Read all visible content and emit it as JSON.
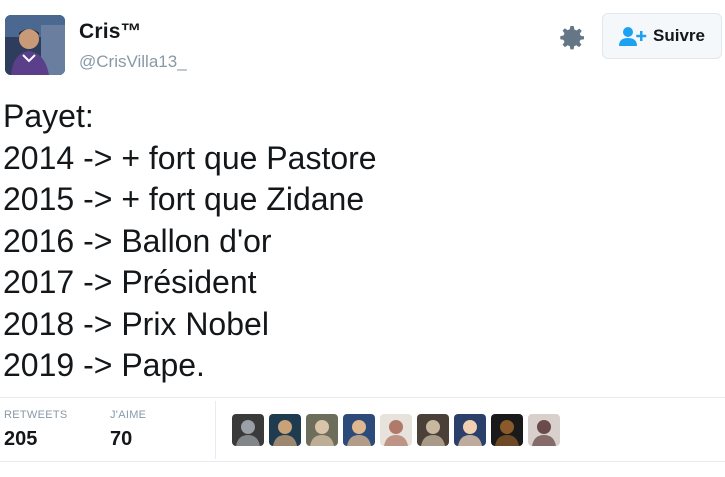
{
  "user": {
    "display_name": "Cris™",
    "screen_name": "@CrisVilla13_",
    "avatar_icon": "profile-photo"
  },
  "header": {
    "settings_icon": "gear-icon",
    "follow_button": {
      "label": "Suivre",
      "icon": "add-user-icon",
      "accent": "#1da1f2"
    }
  },
  "tweet": {
    "lines": [
      "Payet:",
      "2014 -> + fort que Pastore",
      "2015 -> + fort que Zidane",
      "2016 -> Ballon d'or",
      "2017 -> Président",
      "2018 -> Prix Nobel",
      "2019 -> Pape."
    ]
  },
  "stats": {
    "retweets_label": "RETWEETS",
    "retweets_value": "205",
    "likes_label": "J'AIME",
    "likes_value": "70"
  },
  "likers": [
    {
      "name": "liker-avatar-1",
      "color": "#3a3a3a",
      "accent": "#9aa0a6"
    },
    {
      "name": "liker-avatar-2",
      "color": "#1e3b4f",
      "accent": "#c9a27a"
    },
    {
      "name": "liker-avatar-3",
      "color": "#6d6d5c",
      "accent": "#d8c4a8"
    },
    {
      "name": "liker-avatar-4",
      "color": "#2c4a7a",
      "accent": "#e0b890"
    },
    {
      "name": "liker-avatar-5",
      "color": "#e8e2dc",
      "accent": "#b07a6a"
    },
    {
      "name": "liker-avatar-6",
      "color": "#4a4038",
      "accent": "#c8b8a0"
    },
    {
      "name": "liker-avatar-7",
      "color": "#2a3f6a",
      "accent": "#f0d0b0"
    },
    {
      "name": "liker-avatar-8",
      "color": "#1a1a1a",
      "accent": "#8a5a2a"
    },
    {
      "name": "liker-avatar-9",
      "color": "#d8d0cc",
      "accent": "#6a4a4a"
    }
  ]
}
